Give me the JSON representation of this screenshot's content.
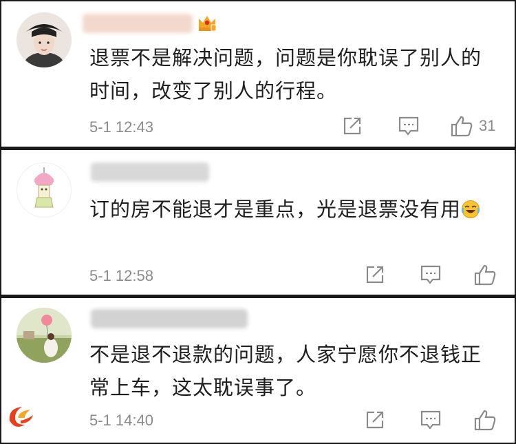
{
  "comments": [
    {
      "text": "退票不是解决问题，问题是你耽误了别人的时间，改变了别人的行程。",
      "time": "5-1 12:43",
      "likes": "31"
    },
    {
      "text": "订的房不能退才是重点，光是退票没有用",
      "time": "5-1 12:58",
      "likes": ""
    },
    {
      "text": "不是退不退款的问题，人家宁愿你不退钱正常上车，这太耽误事了。",
      "time": "5-1 14:40",
      "likes": ""
    }
  ],
  "icons": {
    "share": "share-icon",
    "reply": "comment-icon",
    "like": "thumbs-up-icon",
    "vip": "crown-badge-icon",
    "emoji": "laughing-tears-emoji-icon",
    "logo": "app-logo-icon"
  },
  "colors": {
    "text": "#1e1e1e",
    "meta": "#8a8a8a",
    "vip_badge": "#f5a623"
  }
}
